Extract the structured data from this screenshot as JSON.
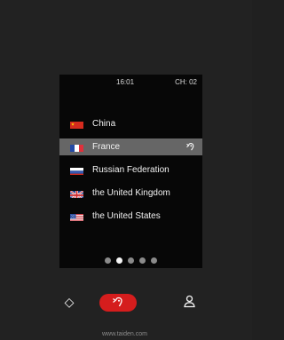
{
  "status": {
    "time": "16:01",
    "channel": "CH: 02"
  },
  "languages": [
    {
      "label": "China",
      "flag": "china-flag"
    },
    {
      "label": "France",
      "flag": "france-flag"
    },
    {
      "label": "Russian Federation",
      "flag": "russia-flag"
    },
    {
      "label": "the United Kingdom",
      "flag": "uk-flag"
    },
    {
      "label": "the United States",
      "flag": "us-flag"
    }
  ],
  "selected_language": "France",
  "pager": {
    "current_page": 2,
    "total_pages": 5
  },
  "icons": {
    "listen": "hearing-icon",
    "home": "home-icon",
    "user": "user-icon"
  },
  "brand": {
    "url": "www.taiden.com"
  },
  "colors": {
    "screen_background": "#070707",
    "selected_row": "#666666",
    "listen_button": "#d51d1d",
    "device_body": "#222222"
  }
}
